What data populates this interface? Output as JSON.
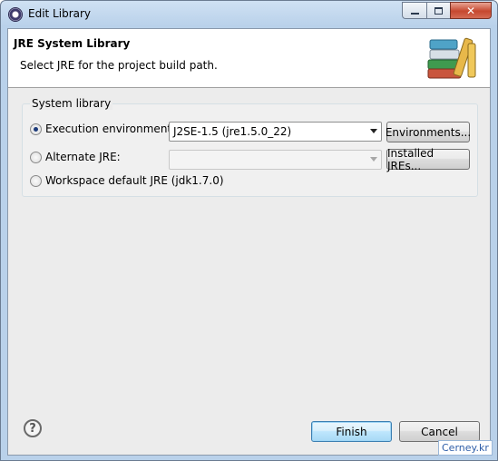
{
  "window": {
    "title": "Edit Library"
  },
  "header": {
    "title": "JRE System Library",
    "description": "Select JRE for the project build path."
  },
  "group": {
    "legend": "System library",
    "options": [
      {
        "label": "Execution environment:",
        "selected": true
      },
      {
        "label": "Alternate JRE:",
        "selected": false
      },
      {
        "label": "Workspace default JRE (jdk1.7.0)",
        "selected": false
      }
    ],
    "execution_env_value": "J2SE-1.5 (jre1.5.0_22)",
    "alternate_jre_value": "",
    "environments_button": "Environments...",
    "installed_jres_button": "Installed JREs..."
  },
  "footer": {
    "help_glyph": "?",
    "finish_label": "Finish",
    "cancel_label": "Cancel"
  },
  "watermark": "Cerney.kr",
  "colors": {
    "title_bar": "#b9d1ea",
    "close_button": "#c6482f",
    "default_button_border": "#3c7fb1"
  }
}
